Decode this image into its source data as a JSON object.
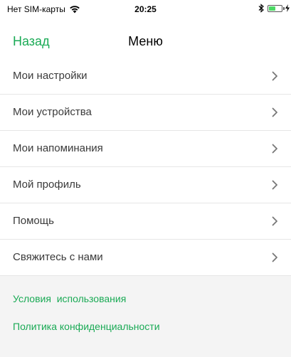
{
  "status_bar": {
    "carrier": "Нет SIM-карты",
    "time": "20:25",
    "battery_level": 0.55,
    "icons": [
      "wifi-icon",
      "bluetooth-icon",
      "battery-icon",
      "charging-icon"
    ]
  },
  "nav": {
    "back_label": "Назад",
    "title": "Меню"
  },
  "menu": {
    "items": [
      {
        "label": "Мои настройки"
      },
      {
        "label": "Мои устройства"
      },
      {
        "label": "Мои напоминания"
      },
      {
        "label": "Мой профиль"
      },
      {
        "label": "Помощь"
      },
      {
        "label": "Свяжитесь с нами"
      }
    ]
  },
  "footer": {
    "terms_label": "Условия  использования",
    "privacy_label": "Политика конфиденциальности"
  },
  "colors": {
    "accent": "#1aaa55",
    "background": "#f4f4f4",
    "battery": "#4cd964"
  }
}
